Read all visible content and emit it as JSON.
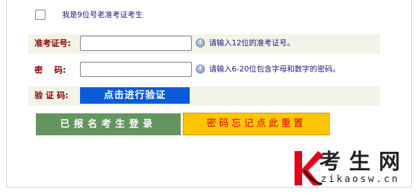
{
  "form": {
    "old_candidate_label": "我是9位号老准考证考生",
    "exam_id_label": "准考证号:",
    "exam_id_value": "",
    "exam_id_hint": "请输入12位的准考证号。",
    "password_label": "密    码:",
    "password_value": "",
    "password_hint": "请输入6-20位包含字母和数字的密码。",
    "captcha_label": "验 证 码:",
    "captcha_button": "点击进行验证",
    "login_button": "已报名考生登录",
    "reset_button": "密码忘记点此重置"
  },
  "logo": {
    "name": "考生网",
    "domain": "zikaosw.cn",
    "letter": "K"
  },
  "colors": {
    "label_red": "#8b0000",
    "hint_blue": "#1a1a7a",
    "captcha_blue": "#0a5cd6",
    "login_green": "#64945f",
    "reset_yellow": "#ffc600",
    "reset_text_red": "#d60000",
    "logo_red": "#e2001a",
    "row_band": "#f1f4e6"
  },
  "icons": [
    "info-icon",
    "checkbox-icon"
  ]
}
